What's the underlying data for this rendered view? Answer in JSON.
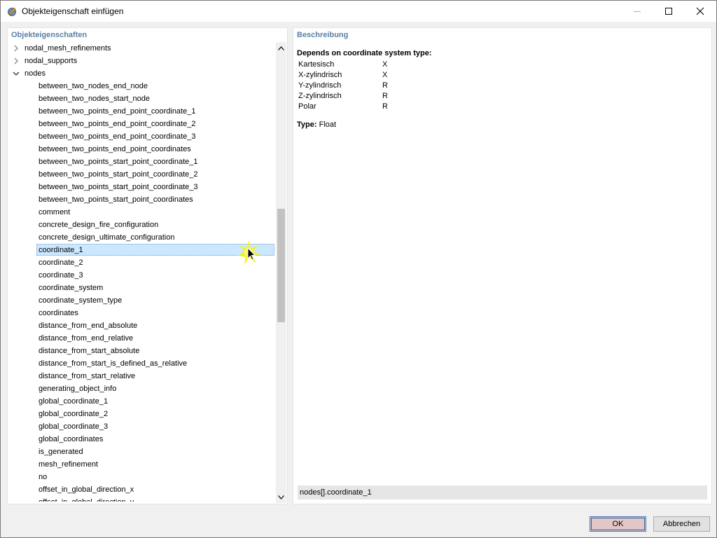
{
  "window": {
    "title": "Objekteigenschaft einfügen",
    "controls": {
      "minimize": "minimize",
      "maximize": "maximize",
      "close": "close"
    }
  },
  "left_panel": {
    "header": "Objekteigenschaften",
    "tree": [
      {
        "label": "nodal_mesh_refinements",
        "level": 0,
        "expanded": false
      },
      {
        "label": "nodal_supports",
        "level": 0,
        "expanded": false
      },
      {
        "label": "nodes",
        "level": 0,
        "expanded": true
      },
      {
        "label": "between_two_nodes_end_node",
        "level": 1
      },
      {
        "label": "between_two_nodes_start_node",
        "level": 1
      },
      {
        "label": "between_two_points_end_point_coordinate_1",
        "level": 1
      },
      {
        "label": "between_two_points_end_point_coordinate_2",
        "level": 1
      },
      {
        "label": "between_two_points_end_point_coordinate_3",
        "level": 1
      },
      {
        "label": "between_two_points_end_point_coordinates",
        "level": 1
      },
      {
        "label": "between_two_points_start_point_coordinate_1",
        "level": 1
      },
      {
        "label": "between_two_points_start_point_coordinate_2",
        "level": 1
      },
      {
        "label": "between_two_points_start_point_coordinate_3",
        "level": 1
      },
      {
        "label": "between_two_points_start_point_coordinates",
        "level": 1
      },
      {
        "label": "comment",
        "level": 1
      },
      {
        "label": "concrete_design_fire_configuration",
        "level": 1
      },
      {
        "label": "concrete_design_ultimate_configuration",
        "level": 1
      },
      {
        "label": "coordinate_1",
        "level": 1,
        "selected": true
      },
      {
        "label": "coordinate_2",
        "level": 1
      },
      {
        "label": "coordinate_3",
        "level": 1
      },
      {
        "label": "coordinate_system",
        "level": 1
      },
      {
        "label": "coordinate_system_type",
        "level": 1
      },
      {
        "label": "coordinates",
        "level": 1
      },
      {
        "label": "distance_from_end_absolute",
        "level": 1
      },
      {
        "label": "distance_from_end_relative",
        "level": 1
      },
      {
        "label": "distance_from_start_absolute",
        "level": 1
      },
      {
        "label": "distance_from_start_is_defined_as_relative",
        "level": 1
      },
      {
        "label": "distance_from_start_relative",
        "level": 1
      },
      {
        "label": "generating_object_info",
        "level": 1
      },
      {
        "label": "global_coordinate_1",
        "level": 1
      },
      {
        "label": "global_coordinate_2",
        "level": 1
      },
      {
        "label": "global_coordinate_3",
        "level": 1
      },
      {
        "label": "global_coordinates",
        "level": 1
      },
      {
        "label": "is_generated",
        "level": 1
      },
      {
        "label": "mesh_refinement",
        "level": 1
      },
      {
        "label": "no",
        "level": 1
      },
      {
        "label": "offset_in_global_direction_x",
        "level": 1
      },
      {
        "label": "offset_in_global_direction_y",
        "level": 1
      }
    ]
  },
  "right_panel": {
    "header": "Beschreibung",
    "heading": "Depends on coordinate system type:",
    "rows": [
      {
        "key": "Kartesisch",
        "value": "X"
      },
      {
        "key": "X-zylindrisch",
        "value": "X"
      },
      {
        "key": "Y-zylindrisch",
        "value": "R"
      },
      {
        "key": "Z-zylindrisch",
        "value": "R"
      },
      {
        "key": "Polar",
        "value": "R"
      }
    ],
    "type_label": "Type:",
    "type_value": "Float",
    "path": "nodes[].coordinate_1"
  },
  "buttons": {
    "ok": "OK",
    "cancel": "Abbrechen"
  },
  "colors": {
    "selection": "#cce8ff",
    "header": "#5b7fa6",
    "ok_bg": "#e3c7c7"
  }
}
